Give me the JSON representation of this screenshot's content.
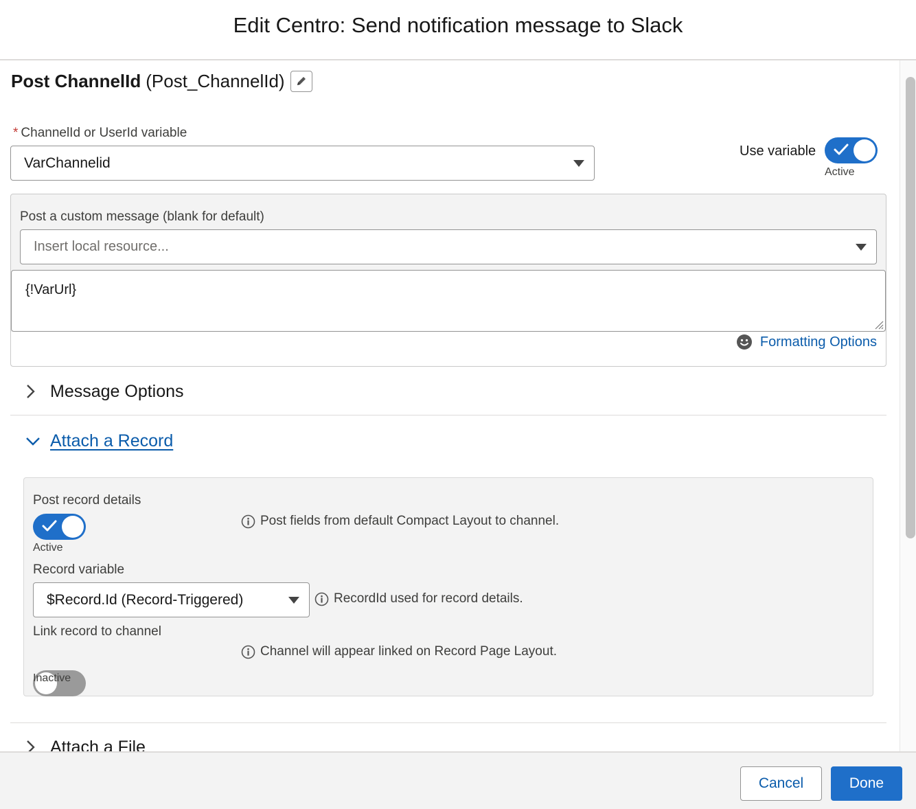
{
  "modal": {
    "title": "Edit Centro: Send notification message to Slack"
  },
  "action": {
    "label": "Post ChannelId",
    "api_name": "(Post_ChannelId)"
  },
  "channel_field": {
    "required_marker": "*",
    "label": "ChannelId or UserId variable",
    "value": "VarChannelid"
  },
  "use_variable": {
    "label": "Use variable",
    "status": "Active",
    "enabled": true
  },
  "custom_message": {
    "label": "Post a custom message (blank for default)",
    "resource_placeholder": "Insert local resource...",
    "text": "{!VarUrl}",
    "formatting_options": "Formatting Options"
  },
  "sections": {
    "message_options": {
      "label": "Message Options",
      "expanded": false
    },
    "attach_record": {
      "label": "Attach a Record",
      "expanded": true
    },
    "attach_file": {
      "label": "Attach a File",
      "expanded": false
    }
  },
  "record": {
    "post_details": {
      "label": "Post record details",
      "status": "Active",
      "enabled": true,
      "info": "Post fields from default Compact Layout to channel."
    },
    "record_variable": {
      "label": "Record variable",
      "value": "$Record.Id (Record-Triggered)",
      "info": "RecordId used for record details."
    },
    "link_channel": {
      "label": "Link record to channel",
      "status": "Inactive",
      "enabled": false,
      "info": "Channel will appear linked on Record Page Layout."
    }
  },
  "footer": {
    "cancel": "Cancel",
    "done": "Done"
  },
  "colors": {
    "brand": "#1f6fc9",
    "link": "#0b5cab",
    "required": "#c23934",
    "toggle_off": "#9a9a9a"
  }
}
